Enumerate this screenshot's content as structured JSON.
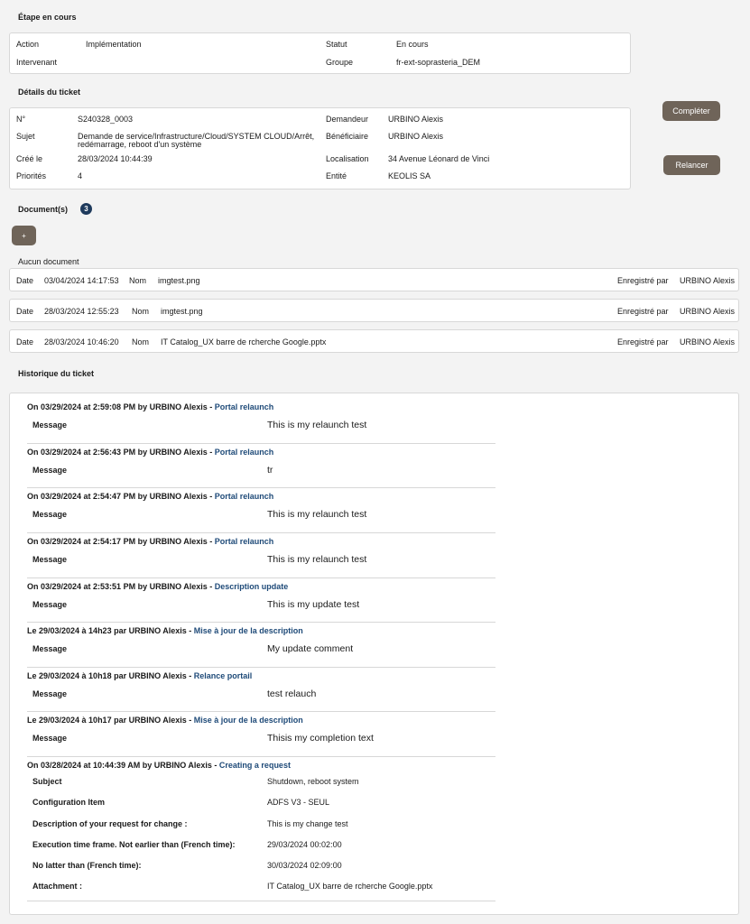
{
  "etape": {
    "title": "Étape en cours",
    "action_label": "Action",
    "action_value": "Implémentation",
    "intervenant_label": "Intervenant",
    "intervenant_value": "",
    "statut_label": "Statut",
    "statut_value": "En cours",
    "groupe_label": "Groupe",
    "groupe_value": "fr-ext-soprasteria_DEM"
  },
  "details": {
    "title": "Détails du ticket",
    "num_label": "N°",
    "num_value": "S240328_0003",
    "sujet_label": "Sujet",
    "sujet_value_line1": "Demande de service/Infrastructure/Cloud/SYSTEM CLOUD/Arrêt,",
    "sujet_value_line2": "redémarrage, reboot d'un système",
    "cree_label": "Créé le",
    "cree_value": "28/03/2024 10:44:39",
    "priorite_label": "Priorités",
    "priorite_value": "4",
    "demandeur_label": "Demandeur",
    "demandeur_value": "URBINO Alexis",
    "beneficiaire_label": "Bénéficiaire",
    "beneficiaire_value": "URBINO Alexis",
    "localisation_label": "Localisation",
    "localisation_value": "34 Avenue Léonard de Vinci",
    "entite_label": "Entité",
    "entite_value": "KEOLIS SA"
  },
  "actions": {
    "completer": "Compléter",
    "relancer": "Relancer"
  },
  "documents": {
    "title": "Document(s)",
    "count": "3",
    "add_label": "+",
    "empty_text": "Aucun document",
    "rows": [
      {
        "date_label": "Date",
        "date": "03/04/2024 14:17:53",
        "nom_label": "Nom",
        "nom": "imgtest.png",
        "by_label": "Enregistré par",
        "by": "URBINO Alexis"
      },
      {
        "date_label": "Date",
        "date": "28/03/2024 12:55:23",
        "nom_label": "Nom",
        "nom": "imgtest.png",
        "by_label": "Enregistré par",
        "by": "URBINO Alexis"
      },
      {
        "date_label": "Date",
        "date": "28/03/2024 10:46:20",
        "nom_label": "Nom",
        "nom": "IT Catalog_UX barre de rcherche Google.pptx",
        "by_label": "Enregistré par",
        "by": "URBINO Alexis"
      }
    ]
  },
  "historique": {
    "title": "Historique du ticket",
    "entries": [
      {
        "head": "On 03/29/2024 at 2:59:08 PM by URBINO Alexis - ",
        "action": "Portal relaunch",
        "label": "Message",
        "value": "This is my relaunch test"
      },
      {
        "head": "On 03/29/2024 at 2:56:43 PM by URBINO Alexis - ",
        "action": "Portal relaunch",
        "label": "Message",
        "value": "tr"
      },
      {
        "head": "On 03/29/2024 at 2:54:47 PM by URBINO Alexis - ",
        "action": "Portal relaunch",
        "label": "Message",
        "value": "This is my relaunch test"
      },
      {
        "head": "On 03/29/2024 at 2:54:17 PM by URBINO Alexis - ",
        "action": "Portal relaunch",
        "label": "Message",
        "value": "This is my relaunch test"
      },
      {
        "head": "On 03/29/2024 at 2:53:51 PM by URBINO Alexis - ",
        "action": "Description update",
        "label": "Message",
        "value": "This is my update test"
      },
      {
        "head": "Le 29/03/2024 à 14h23 par URBINO Alexis - ",
        "action": "Mise à jour de la description",
        "label": "Message",
        "value": "My update comment"
      },
      {
        "head": "Le 29/03/2024 à 10h18 par URBINO Alexis - ",
        "action": "Relance portail",
        "label": "Message",
        "value": "test relauch"
      },
      {
        "head": "Le 29/03/2024 à 10h17 par URBINO Alexis - ",
        "action": "Mise à jour de la description",
        "label": "Message",
        "value": "Thisis my completion text"
      }
    ],
    "last": {
      "head": "On 03/28/2024 at 10:44:39 AM by URBINO Alexis - ",
      "action": "Creating a request",
      "fields": [
        {
          "label": "Subject",
          "value": "Shutdown, reboot system"
        },
        {
          "label": "Configuration Item",
          "value": "ADFS V3 - SEUL"
        },
        {
          "label": "Description of your request for change :",
          "value": "This is my change test"
        },
        {
          "label": "Execution time frame. Not earlier than (French time):",
          "value": "29/03/2024 00:02:00"
        },
        {
          "label": "No latter than (French time):",
          "value": "30/03/2024 02:09:00"
        },
        {
          "label": "Attachment :",
          "value": "IT Catalog_UX barre de rcherche Google.pptx"
        }
      ]
    }
  }
}
